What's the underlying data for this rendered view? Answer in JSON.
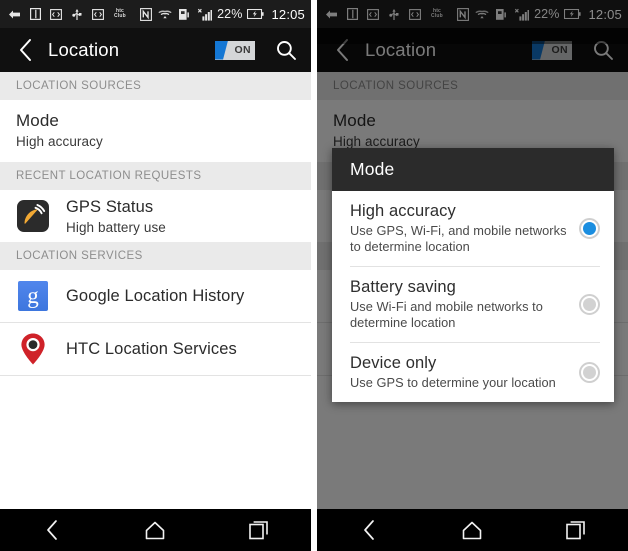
{
  "status_bar": {
    "icons": [
      {
        "name": "notification-arrow-icon",
        "glyph": "arrow-left-badge"
      },
      {
        "name": "sd-card-icon",
        "glyph": "book"
      },
      {
        "name": "debug-icon",
        "glyph": "code-box"
      },
      {
        "name": "usb-icon",
        "glyph": "usb"
      },
      {
        "name": "developer-icon",
        "glyph": "code-box-2"
      },
      {
        "name": "htc-club-icon",
        "glyph": "htc-club"
      }
    ],
    "htc_club_line1": "htc",
    "htc_club_line2": "Club",
    "nfc_label": "N",
    "battery_percent": "22%",
    "clock": "12:05"
  },
  "action_bar": {
    "title": "Location",
    "toggle_label": "ON",
    "toggle_state": "on",
    "back_icon": "back-chevron-icon",
    "search_icon": "search-icon"
  },
  "sections": [
    {
      "header": "LOCATION SOURCES",
      "rows": [
        {
          "name": "mode-row",
          "title": "Mode",
          "subtitle": "High accuracy",
          "icon": null
        }
      ]
    },
    {
      "header": "RECENT LOCATION REQUESTS",
      "rows": [
        {
          "name": "gps-status-row",
          "title": "GPS Status",
          "subtitle": "High battery use",
          "icon": "gps-status-app-icon"
        }
      ]
    },
    {
      "header": "LOCATION SERVICES",
      "rows": [
        {
          "name": "google-location-history-row",
          "title": "Google Location History",
          "subtitle": null,
          "icon": "google-g-icon",
          "icon_letter": "g"
        },
        {
          "name": "htc-location-services-row",
          "title": "HTC Location Services",
          "subtitle": null,
          "icon": "map-pin-icon"
        }
      ]
    }
  ],
  "dialog": {
    "title": "Mode",
    "options": [
      {
        "name": "High accuracy",
        "description": "Use GPS, Wi-Fi, and mobile networks to determine location",
        "selected": true
      },
      {
        "name": "Battery saving",
        "description": "Use Wi-Fi and mobile networks to determine location",
        "selected": false
      },
      {
        "name": "Device only",
        "description": "Use GPS to determine your location",
        "selected": false
      }
    ]
  },
  "nav_bar": {
    "back_icon": "nav-back-icon",
    "home_icon": "nav-home-icon",
    "recents_icon": "nav-recents-icon"
  },
  "colors": {
    "accent_blue": "#1b8ee0",
    "toggle_blue": "#1477d4",
    "section_bg": "#eaeaea",
    "action_bar": "#101010",
    "dialog_title_bg": "#2b2b2b"
  }
}
